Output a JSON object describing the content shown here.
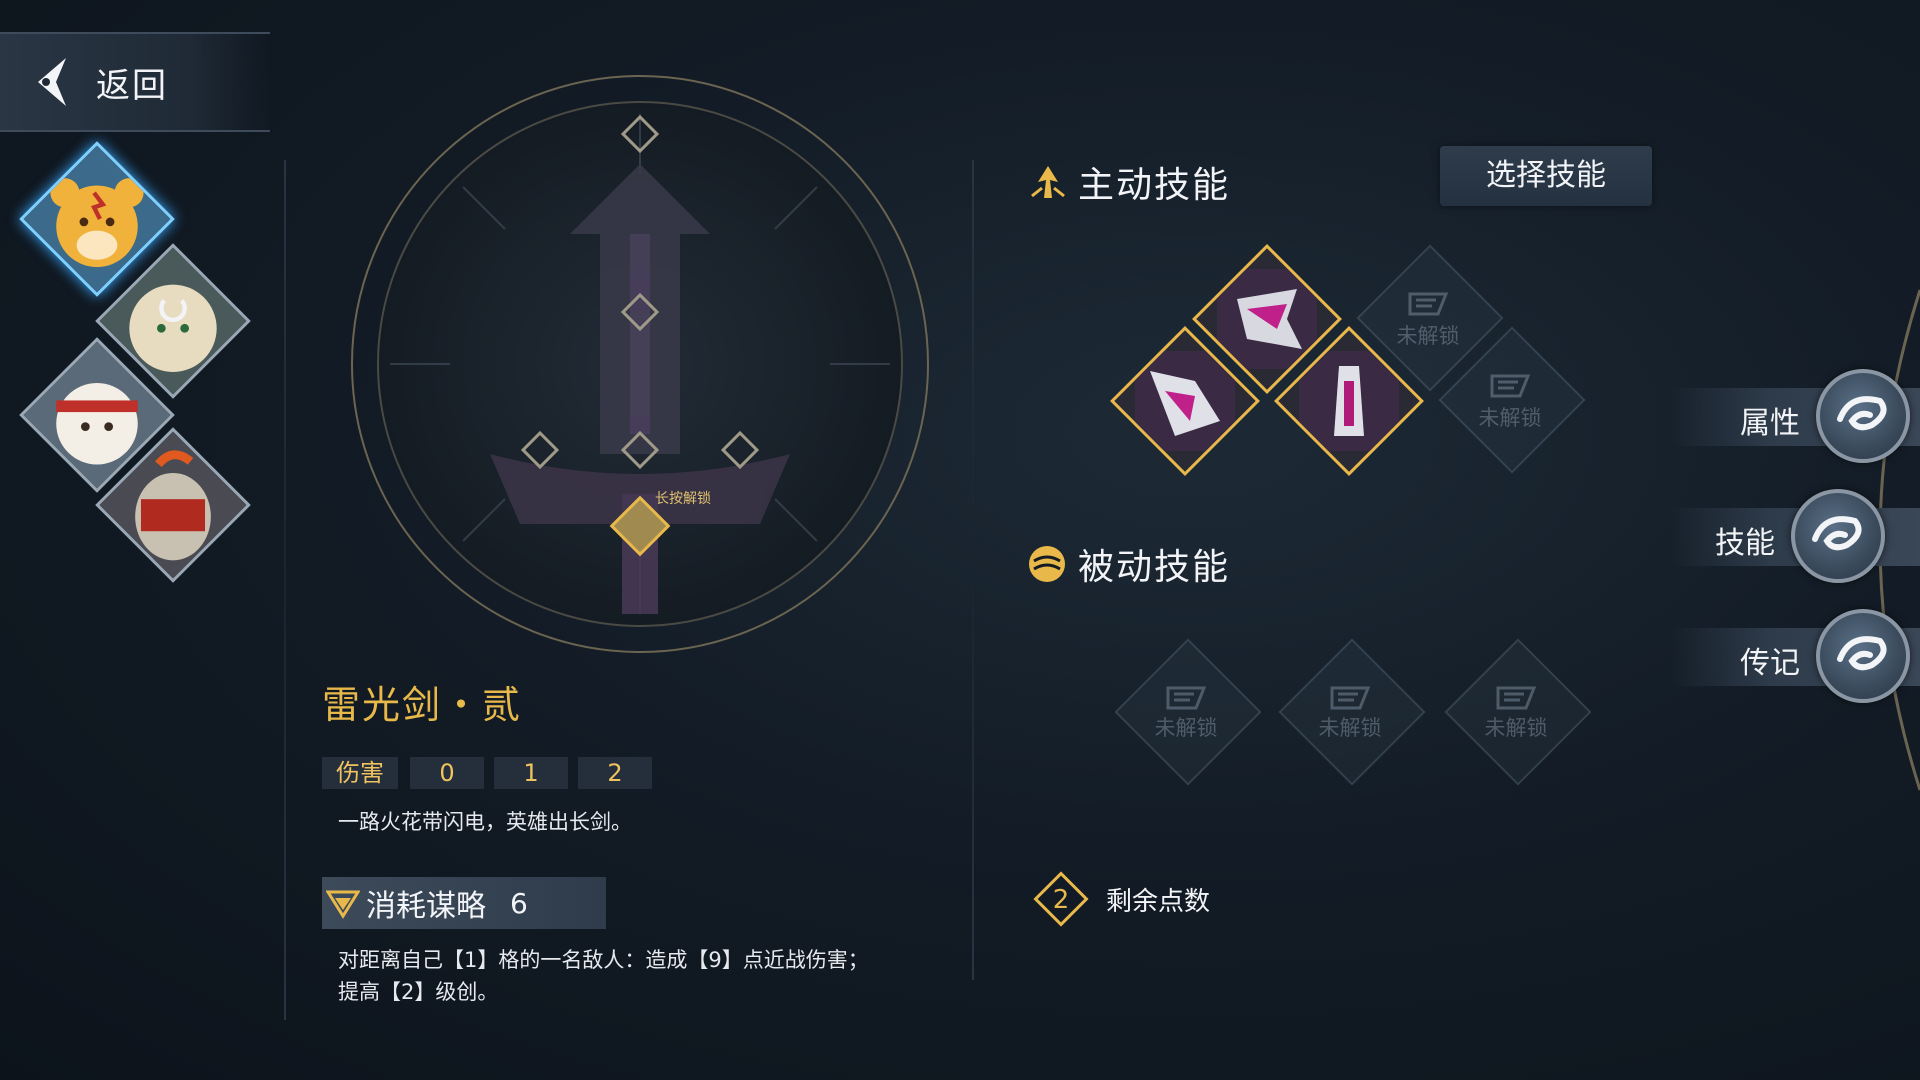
{
  "back": {
    "label": "返回"
  },
  "skill": {
    "name": "雷光剑・贰",
    "stat_label": "伤害",
    "stat_levels": [
      "0",
      "1",
      "2"
    ],
    "description": "一路火花带闪电，英雄出长剑。",
    "cost_label": "消耗谋略",
    "cost_value": "6",
    "effect_line1": "对距离自己【1】格的一名敌人：造成【9】点近战伤害；",
    "effect_line2": "提高【2】级创。"
  },
  "tree": {
    "hold_hint": "长按解锁"
  },
  "active": {
    "title": "主动技能",
    "select_label": "选择技能"
  },
  "passive": {
    "title": "被动技能"
  },
  "locked_label": "未解锁",
  "points": {
    "value": "2",
    "label": "剩余点数"
  },
  "tabs": [
    {
      "label": "属性"
    },
    {
      "label": "技能"
    },
    {
      "label": "传记"
    }
  ],
  "colors": {
    "accent_gold": "#e8b94a",
    "active_glow": "#3aa8ff"
  }
}
